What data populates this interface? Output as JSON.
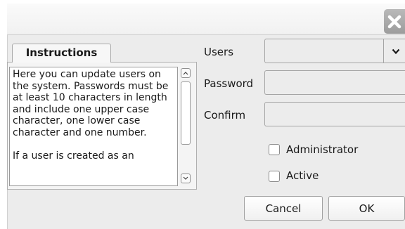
{
  "dialog": {
    "close_label": "close"
  },
  "instructions": {
    "tab_label": "Instructions",
    "text": "Here you can update users on the system. Passwords must be at least 10 characters in length and include one upper case character, one lower case character and one number.\n\nIf a user is created as an"
  },
  "form": {
    "users_label": "Users",
    "users_value": "",
    "password_label": "Password",
    "password_value": "",
    "confirm_label": "Confirm",
    "confirm_value": ""
  },
  "checkboxes": {
    "administrator_label": "Administrator",
    "administrator_checked": false,
    "active_label": "Active",
    "active_checked": false
  },
  "buttons": {
    "cancel_label": "Cancel",
    "ok_label": "OK"
  },
  "colors": {
    "dialog_background": "#ececec",
    "close_button": "#a8a8a8"
  }
}
